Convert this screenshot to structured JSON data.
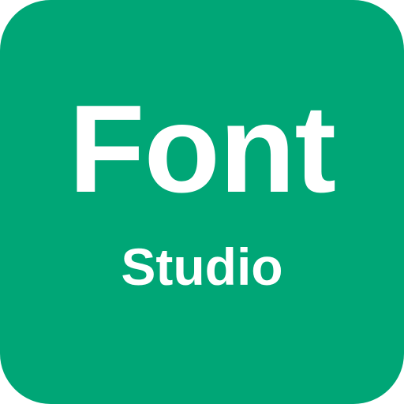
{
  "app_icon": {
    "background_color": "#00A676",
    "primary_text": "Font",
    "secondary_text": "Studio",
    "text_color": "#FFFFFF"
  }
}
